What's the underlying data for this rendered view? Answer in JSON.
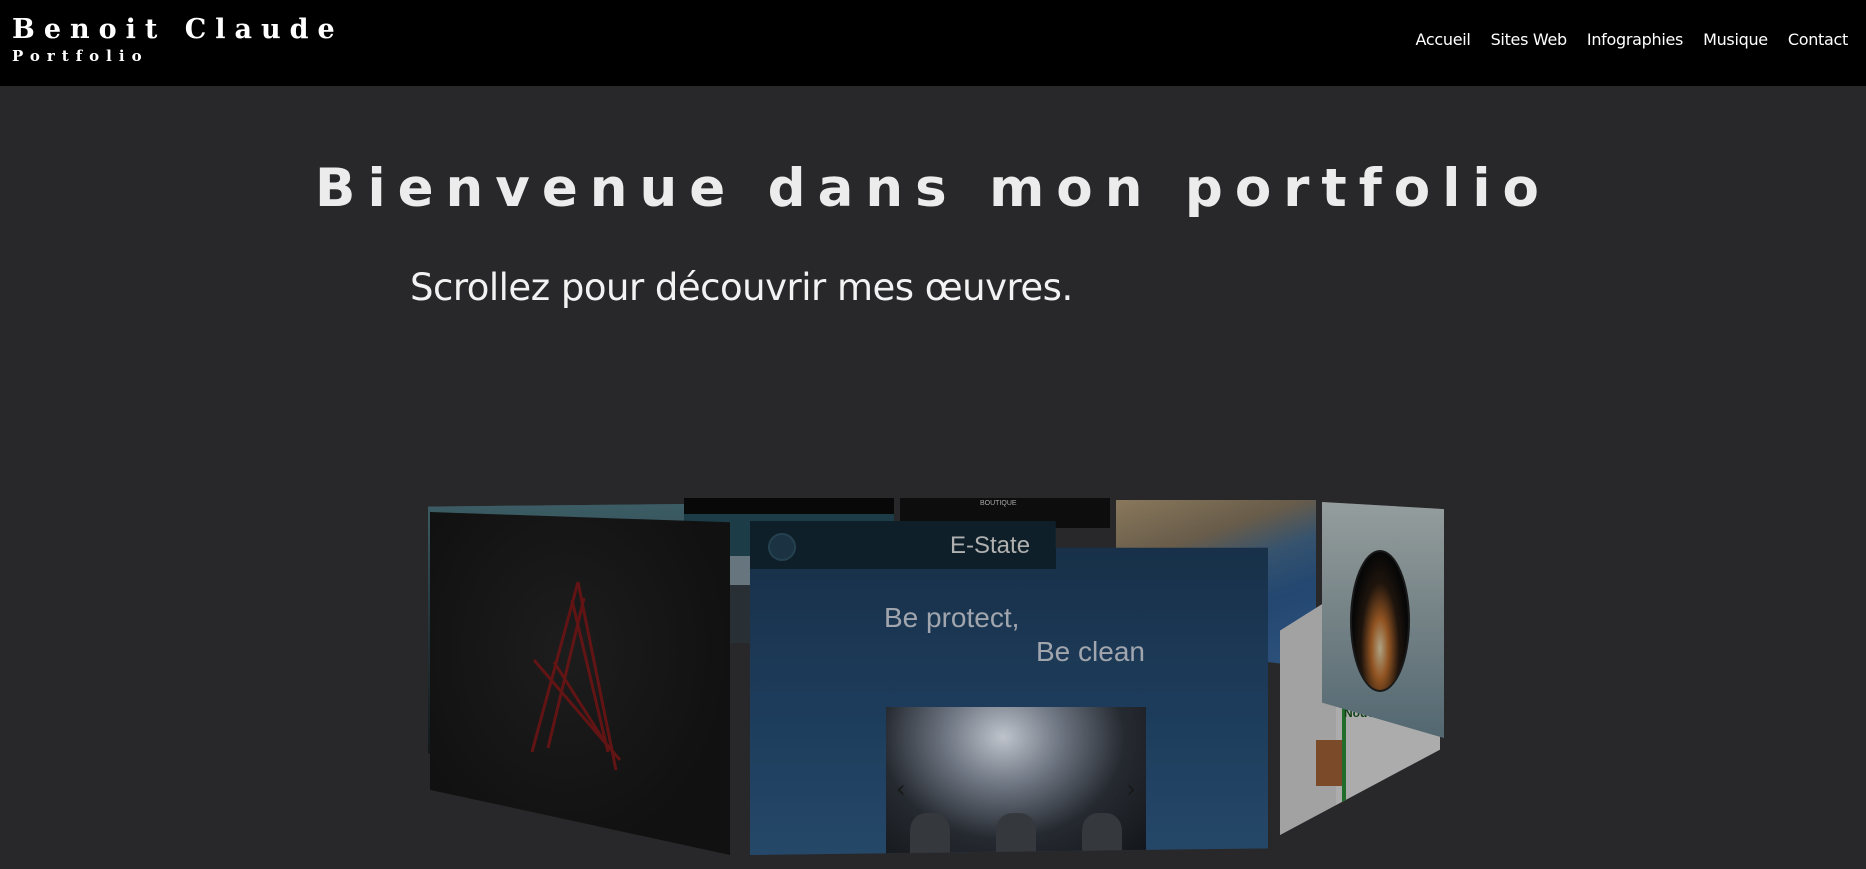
{
  "header": {
    "brand_name": "Benoit Claude",
    "brand_subtitle": "Portfolio",
    "nav": [
      {
        "label": "Accueil"
      },
      {
        "label": "Sites Web"
      },
      {
        "label": "Infographies"
      },
      {
        "label": "Musique"
      },
      {
        "label": "Contact"
      }
    ]
  },
  "hero": {
    "title": "Bienvenue dans mon portfolio",
    "subtitle": "Scrollez pour découvrir mes œuvres."
  },
  "carousel": {
    "estate": {
      "title": "E-State",
      "line1": "Be protect,",
      "line2": "Be clean"
    },
    "shop_text": "BOUTIQUE",
    "green_site_text": "Nouve"
  },
  "colors": {
    "page_background": "#28282a",
    "header_background": "#000000",
    "text": "#ffffff"
  }
}
